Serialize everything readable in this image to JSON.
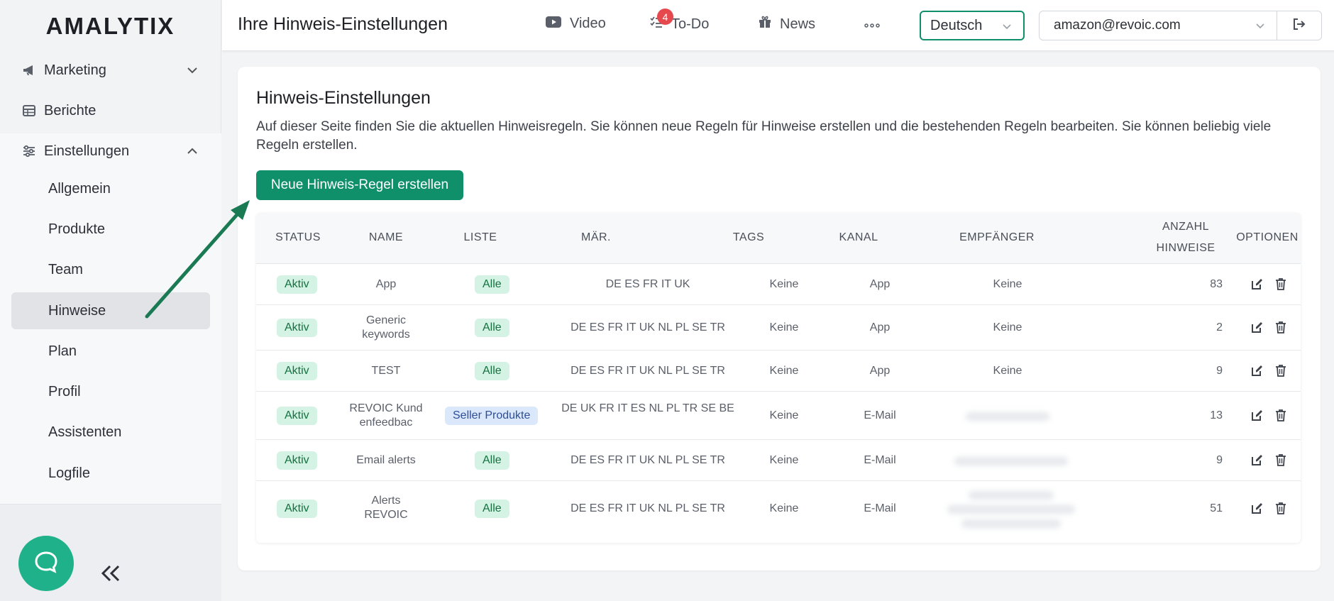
{
  "app": {
    "logo": "AMALYTIX"
  },
  "sidebar": {
    "items": [
      {
        "label": "Marketing",
        "icon": "megaphone-icon"
      },
      {
        "label": "Berichte",
        "icon": "table-icon"
      },
      {
        "label": "Einstellungen",
        "icon": "sliders-icon"
      }
    ],
    "sub_items": [
      "Allgemein",
      "Produkte",
      "Team",
      "Hinweise",
      "Plan",
      "Profil",
      "Assistenten",
      "Logfile"
    ],
    "active": "Hinweise"
  },
  "header": {
    "title": "Ihre Hinweis-Einstellungen",
    "video_label": "Video",
    "todo_label": "To-Do",
    "todo_count": "4",
    "news_label": "News",
    "language": "Deutsch",
    "account": "amazon@revoic.com"
  },
  "main": {
    "heading": "Hinweis-Einstellungen",
    "description": "Auf dieser Seite finden Sie die aktuellen Hinweisregeln. Sie können neue Regeln für Hinweise erstellen und die bestehenden Regeln bearbeiten. Sie können beliebig viele Regeln erstellen.",
    "new_rule_button": "Neue Hinweis-Regel erstellen"
  },
  "table": {
    "headers": {
      "status": "STATUS",
      "name": "NAME",
      "list": "LISTE",
      "markets": "MÄR.",
      "tags": "TAGS",
      "channel": "KANAL",
      "recipient": "EMPFÄNGER",
      "count_line1": "ANZAHL",
      "count_line2": "HINWEISE",
      "options": "OPTIONEN"
    },
    "rows": [
      {
        "status": "Aktiv",
        "name": "App",
        "list": "Alle",
        "markets": "DE ES FR IT UK",
        "tags": "Keine",
        "channel": "App",
        "recipient": "Keine",
        "count": "83"
      },
      {
        "status": "Aktiv",
        "name": "Generic keywords",
        "list": "Alle",
        "markets": "DE ES FR IT UK NL PL SE TR",
        "tags": "Keine",
        "channel": "App",
        "recipient": "Keine",
        "count": "2"
      },
      {
        "status": "Aktiv",
        "name": "TEST",
        "list": "Alle",
        "markets": "DE ES FR IT UK NL PL SE TR",
        "tags": "Keine",
        "channel": "App",
        "recipient": "Keine",
        "count": "9"
      },
      {
        "status": "Aktiv",
        "name": "REVOIC Kundenfeedbac",
        "list": "Seller Produkte",
        "markets": "DE UK FR IT ES NL PL TR SE BE",
        "tags": "Keine",
        "channel": "E-Mail",
        "recipient": "",
        "count": "13"
      },
      {
        "status": "Aktiv",
        "name": "Email alerts",
        "list": "Alle",
        "markets": "DE ES FR IT UK NL PL SE TR",
        "tags": "Keine",
        "channel": "E-Mail",
        "recipient": "",
        "count": "9"
      },
      {
        "status": "Aktiv",
        "name": "Alerts REVOIC",
        "list": "Alle",
        "markets": "DE ES FR IT UK NL PL SE TR",
        "tags": "Keine",
        "channel": "E-Mail",
        "recipient": "",
        "count": "51"
      }
    ]
  },
  "colors": {
    "accent": "#10906a",
    "badge_green_bg": "#d4f3e4",
    "badge_blue_bg": "#dbe7fb",
    "arrow": "#1a7a54"
  }
}
